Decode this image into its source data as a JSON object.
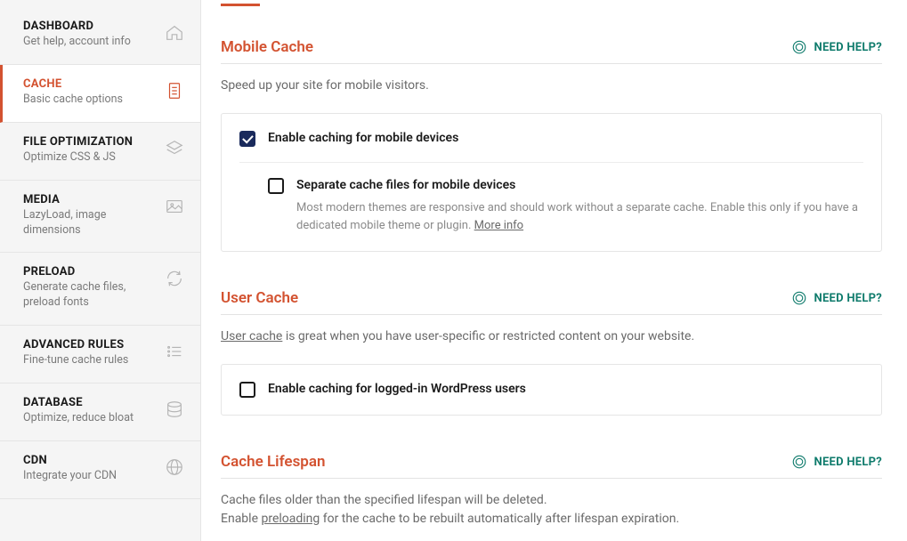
{
  "sidebar": {
    "items": [
      {
        "title": "DASHBOARD",
        "sub": "Get help, account info",
        "icon": "home-icon"
      },
      {
        "title": "CACHE",
        "sub": "Basic cache options",
        "icon": "document-icon",
        "active": true
      },
      {
        "title": "FILE OPTIMIZATION",
        "sub": "Optimize CSS & JS",
        "icon": "layers-icon"
      },
      {
        "title": "MEDIA",
        "sub": "LazyLoad, image dimensions",
        "icon": "image-icon"
      },
      {
        "title": "PRELOAD",
        "sub": "Generate cache files, preload fonts",
        "icon": "refresh-icon"
      },
      {
        "title": "ADVANCED RULES",
        "sub": "Fine-tune cache rules",
        "icon": "list-icon"
      },
      {
        "title": "DATABASE",
        "sub": "Optimize, reduce bloat",
        "icon": "database-icon"
      },
      {
        "title": "CDN",
        "sub": "Integrate your CDN",
        "icon": "globe-icon"
      }
    ]
  },
  "help_label": "NEED HELP?",
  "sections": {
    "mobile": {
      "title": "Mobile Cache",
      "desc": "Speed up your site for mobile visitors.",
      "opt1": "Enable caching for mobile devices",
      "opt2": "Separate cache files for mobile devices",
      "opt2_desc_pre": "Most modern themes are responsive and should work without a separate cache. Enable this only if you have a dedicated mobile theme or plugin. ",
      "opt2_more": "More info"
    },
    "user": {
      "title": "User Cache",
      "desc_link": "User cache",
      "desc_rest": " is great when you have user-specific or restricted content on your website.",
      "opt1": "Enable caching for logged-in WordPress users"
    },
    "lifespan": {
      "title": "Cache Lifespan",
      "desc_line1": "Cache files older than the specified lifespan will be deleted.",
      "desc_pre": "Enable ",
      "desc_link": "preloading",
      "desc_post": " for the cache to be rebuilt automatically after lifespan expiration."
    }
  }
}
